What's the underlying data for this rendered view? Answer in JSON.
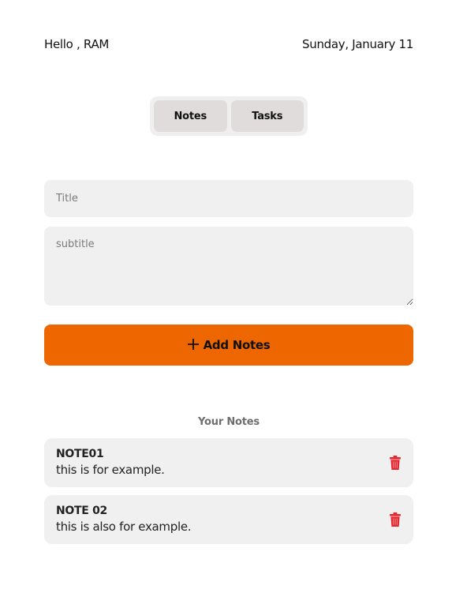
{
  "header": {
    "greeting": "Hello , RAM",
    "date": "Sunday, January 11"
  },
  "tabs": [
    {
      "label": "Notes"
    },
    {
      "label": "Tasks"
    }
  ],
  "form": {
    "title_placeholder": "Title",
    "title_value": "",
    "subtitle_placeholder": "subtitle",
    "subtitle_value": "",
    "add_icon": "plus-icon",
    "add_label": "Add Notes"
  },
  "notes_section": {
    "heading": "Your Notes",
    "notes": [
      {
        "title": "NOTE01",
        "subtitle": "this is for example.",
        "icon": "trash-icon"
      },
      {
        "title": "NOTE 02",
        "subtitle": "this is also for example.",
        "icon": "trash-icon"
      }
    ]
  },
  "colors": {
    "accent": "#ee6600",
    "delete": "#e8242c",
    "field_background": "#f0f0f0",
    "tab_background": "#e0dcdc"
  }
}
